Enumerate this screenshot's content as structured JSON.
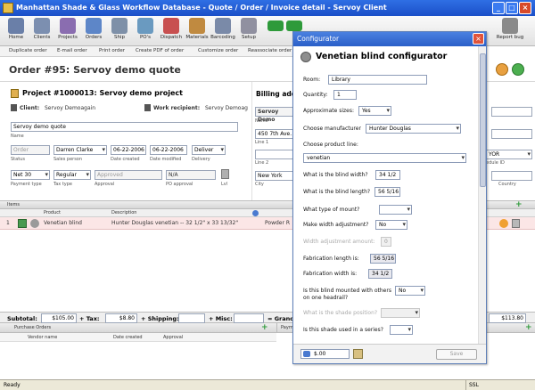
{
  "window": {
    "title": "Manhattan Shade & Glass Workflow Database - Quote / Order / Invoice detail - Servoy Client",
    "min": "_",
    "max": "□",
    "close": "×"
  },
  "toolbar": {
    "buttons": [
      {
        "label": "Home",
        "icon": "home-icon",
        "color": "#6a7fa8"
      },
      {
        "label": "Clients",
        "icon": "clients-icon",
        "color": "#7c8fb0"
      },
      {
        "label": "Projects",
        "icon": "projects-icon",
        "color": "#8a6db0"
      },
      {
        "label": "Orders",
        "icon": "orders-icon",
        "color": "#5d86c8"
      },
      {
        "label": "Ship",
        "icon": "ship-icon",
        "color": "#7e90a8"
      },
      {
        "label": "PO's",
        "icon": "po-icon",
        "color": "#6a9ac0"
      },
      {
        "label": "Dispatch",
        "icon": "dispatch-icon",
        "color": "#c85050"
      },
      {
        "label": "Materials",
        "icon": "materials-icon",
        "color": "#c08a40"
      },
      {
        "label": "Barcoding",
        "icon": "barcoding-icon",
        "color": "#7a8aa8"
      },
      {
        "label": "Setup",
        "icon": "setup-icon",
        "color": "#9090a0"
      }
    ],
    "right_buttons": [
      {
        "label": "Report bug",
        "icon": "bug-icon",
        "color": "#8a8a8a"
      }
    ],
    "nav": {
      "back": "back-arrow-icon",
      "forward": "forward-arrow-icon",
      "green": "#2e9a3a"
    }
  },
  "subtoolbar": [
    "Duplicate order",
    "E-mail order",
    "Print order",
    "Create PDF of order",
    "Customize order",
    "Reassociate order"
  ],
  "order": {
    "title": "Order #95: Servoy demo quote"
  },
  "project": {
    "title": "Project #1000013: Servoy demo project",
    "client_label": "Client:",
    "client": "Servoy Demoagain",
    "recipient_label": "Work recipient:",
    "recipient": "Servoy Demoag",
    "name_value": "Servoy demo quote",
    "name_label": "Name",
    "status_placeholder": "Order",
    "status_label": "Status",
    "salesperson": "Darren Clarke",
    "salesperson_label": "Sales person",
    "date_created": "06-22-2006",
    "date_created_label": "Date created",
    "date_modified": "06-22-2006",
    "date_modified_label": "Date modified",
    "delivery": "Deliver",
    "delivery_label": "Delivery",
    "payment": "Net 30",
    "payment_label": "Payment type",
    "tax": "Regular",
    "tax_label": "Tax type",
    "approval_placeholder": "Approved",
    "approval_label": "Approval",
    "po_approval": "N/A",
    "po_approval_label": "PO approval",
    "lvl_label": "Lvl"
  },
  "billing": {
    "title": "Billing addre",
    "company": "Servoy Demo",
    "name_label": "Name",
    "line1": "450 7th Ave.",
    "line1_label": "Line 1",
    "line2_label": "Line 2",
    "city": "New York",
    "city_label": "City",
    "country_label": "Country",
    "schedule_value": "YOR",
    "schedule_label": "edule ID"
  },
  "items": {
    "bar_label": "Items",
    "headers": [
      "Product",
      "Description"
    ],
    "row": {
      "num": "1",
      "product": "Venetian blind",
      "description": "Hunter Douglas venetian -- 32 1/2\" x 33 13/32\"",
      "location": "Powder R"
    }
  },
  "totals": {
    "subtotal_label": "Subtotal:",
    "subtotal": "$105.00",
    "tax_label": "+ Tax:",
    "tax": "$8.80",
    "shipping_label": "+ Shipping:",
    "misc_label": "+ Misc:",
    "grand_label": "= Grand",
    "grand": "$113.80"
  },
  "purchase_orders": {
    "bar_label": "Purchase Orders",
    "headers": [
      "Vendor name",
      "Date created",
      "Approval"
    ],
    "right_label": "Paym"
  },
  "status": {
    "text": "Ready",
    "ssl": "SSL"
  },
  "dialog": {
    "title": "Configurator",
    "heading": "Venetian blind configurator",
    "room_label": "Room:",
    "room": "Library",
    "quantity_label": "Quantity:",
    "quantity": "1",
    "approx_label": "Approximate sizes:",
    "approx": "Yes",
    "manufacturer_label": "Choose manufacturer",
    "manufacturer": "Hunter Douglas",
    "product_line_label": "Choose product line:",
    "product_line": "venetian",
    "width_label": "What is the blind width?",
    "width": "34 1/2",
    "length_label": "What is the blind length?",
    "length": "56 5/16",
    "mount_label": "What type of mount?",
    "width_adj_label": "Make width adjustment?",
    "width_adj": "No",
    "width_amount_label": "Width adjustment amount:",
    "width_amount": "0",
    "fab_length_label": "Fabrication length is:",
    "fab_length": "56 5/16",
    "fab_width_label": "Fabrication width is:",
    "fab_width": "34 1/2",
    "mounted_label_1": "Is this blind mounted with others",
    "mounted_label_2": "on one headrail?",
    "mounted": "No",
    "shade_position_label": "What is the shade position?",
    "series_label": "Is this shade used in a series?",
    "price": "$.00",
    "save_label": "Save"
  }
}
